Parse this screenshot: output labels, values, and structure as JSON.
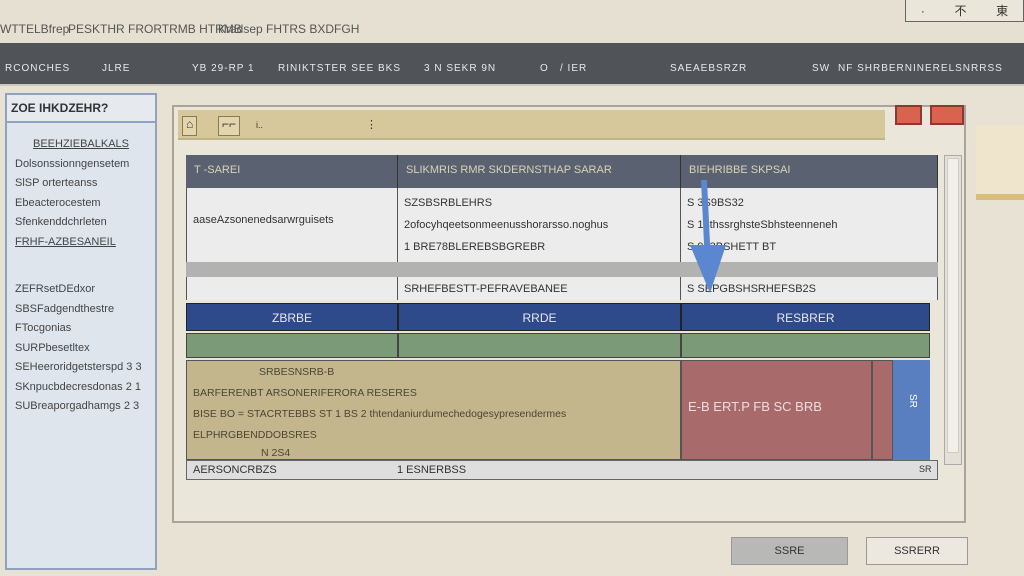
{
  "titlebar": {
    "items": [
      "WTTELBfrep",
      "PESKTHR FRORTRMB HTRMB",
      "Kradsep FHTRS BXDFGH"
    ],
    "window_controls": [
      "·",
      "不",
      "東"
    ]
  },
  "toolbar": {
    "items": [
      "RCONCHES",
      "JLRE",
      "YB 29-RP 1",
      "RINIKTSTER SEE BKS",
      "3 N SEKR 9N",
      "O",
      "/ IER",
      "SAEAEBSRZR",
      "SW",
      "NF SHRBERNINERELSNRRSS"
    ]
  },
  "sidebar": {
    "title": "ZOE IHKDZEHR?",
    "section": "BEEHZIEBALKALS",
    "items": [
      "Dolsonssionngensetem",
      "SlSP orterteanss",
      "Ebeacterocestem",
      "Sfenkenddchrleten",
      "FRHF-AZBESANEIL",
      "ZEFRsetDEdxor",
      "SBSFadgendthestre",
      "FTocgonias",
      "SURPbesetltex",
      "SEHeeroridgetsterspd 3 3",
      "SKnpucbdecresdonas 2 1",
      "SUBreaporgadhamgs 2 3"
    ]
  },
  "toolbar2": {
    "icons": [
      "image-icon",
      "frame-icon"
    ],
    "dots": "i.."
  },
  "table": {
    "headers": [
      "T -SAREI",
      "SLIKMRIS RMR SKDERNSTHAP SARAR",
      "BIEHRIBBE SKPSAI"
    ],
    "col1": [
      "aaseAzsonenedsarwrguisets"
    ],
    "col2": [
      "SZSBSRBLEHRS",
      "2ofocyhqeetsonmeenusshorarsso.noghus",
      "1 BRE78BLEREBSBGREBR"
    ],
    "col3": [
      "S 3S9BS32",
      "S 18thssrghsteSbhsteenneneh",
      "S 923BSHETT BT"
    ],
    "row3": [
      "",
      "SRHEFBESTT-PEFRAVEBANEE",
      "S SEPGBSHSRHEFSB2S"
    ],
    "blue_row": [
      "ZBRBE",
      "RRDE",
      "RESBRER"
    ],
    "tan_block": [
      "SRBESNSRB-B",
      "BARFERENBT   ARSONERIFERORA RESERES",
      "BISE BO =  STACRTEBBS ST 1 BS 2 thtendaniurdumechedogesypresendermes",
      "ELPHRGBENDDOBSRES",
      "N 2S4"
    ],
    "red_block": "E-B ERT.P FB SC  BRB",
    "blue_cell": "SR",
    "footer": [
      "AERSONCRBZS",
      "1 ESNERBSS",
      "SR"
    ]
  },
  "buttons": {
    "ok": "SSRE",
    "cancel": "SSRERR"
  },
  "colors": {
    "header": "#5a6170",
    "blue": "#2f4a8a",
    "green": "#7a9a78",
    "tan": "#c4b68c",
    "red": "#a86a6a",
    "accent": "#5a7fc0"
  }
}
